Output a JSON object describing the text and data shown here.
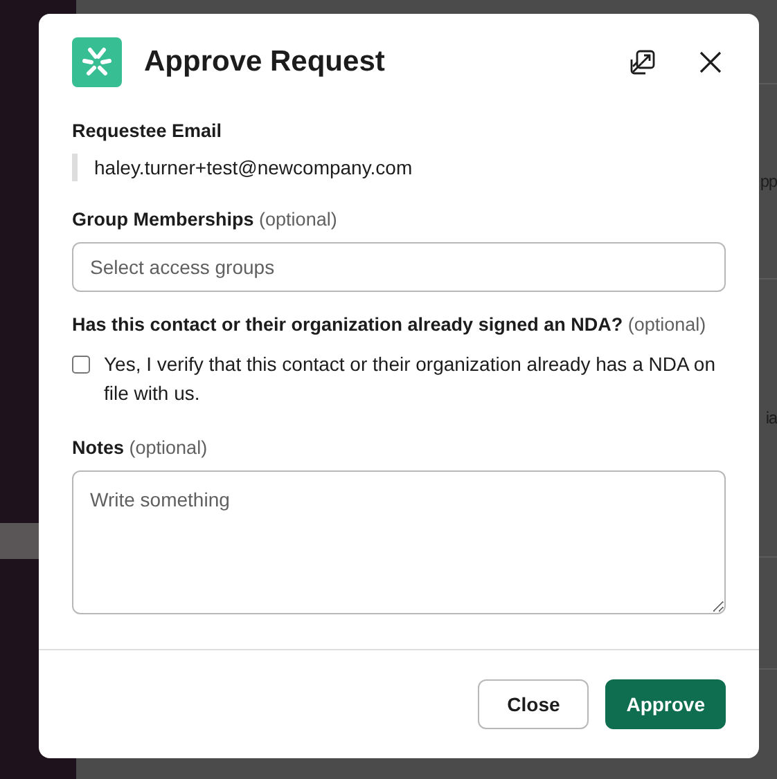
{
  "background": {
    "fragments": [
      "pp",
      "ia"
    ]
  },
  "modal": {
    "title": "Approve Request",
    "email": {
      "label": "Requestee Email",
      "value": "haley.turner+test@newcompany.com"
    },
    "groups": {
      "label": "Group Memberships",
      "optional": "(optional)",
      "placeholder": "Select access groups"
    },
    "nda": {
      "label": "Has this contact or their organization already signed an NDA?",
      "optional": "(optional)",
      "option": "Yes, I verify that this contact or their organization already has a NDA on file with us.",
      "checked": false
    },
    "notes": {
      "label": "Notes",
      "optional": "(optional)",
      "placeholder": "Write something"
    },
    "buttons": [
      {
        "label": "Close",
        "kind": "secondary"
      },
      {
        "label": "Approve",
        "kind": "primary"
      }
    ]
  }
}
